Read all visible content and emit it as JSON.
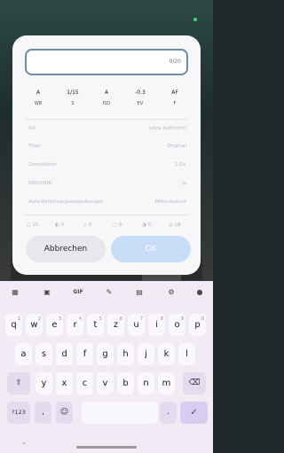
{
  "dialog": {
    "name_counter": "0/20",
    "params": [
      {
        "value": "A",
        "key": "WB"
      },
      {
        "value": "1/15",
        "key": "S"
      },
      {
        "value": "A",
        "key": "ISO"
      },
      {
        "value": "-0.3",
        "key": "EV"
      },
      {
        "value": "AF",
        "key": "F"
      }
    ],
    "rows": [
      {
        "label": "Stil",
        "value": "Leica Authentic"
      },
      {
        "label": "Filter",
        "value": "Original"
      },
      {
        "label": "Zoomfaktor",
        "value": "1.0×"
      },
      {
        "label": "DRO/HDR",
        "value": "Ja"
      },
      {
        "label": "Auto-Belichtungseinstellungen",
        "value": "Mittenbetont"
      }
    ],
    "counts": [
      "15",
      "0",
      "0",
      "0",
      "0",
      "18"
    ],
    "cancel_label": "Abbrechen",
    "ok_label": "OK"
  },
  "keyboard": {
    "toolbar": {
      "gif_label": "GIF"
    },
    "row1": [
      {
        "k": "q",
        "h": "1"
      },
      {
        "k": "w",
        "h": "2"
      },
      {
        "k": "e",
        "h": "3"
      },
      {
        "k": "r",
        "h": "4"
      },
      {
        "k": "t",
        "h": "5"
      },
      {
        "k": "z",
        "h": "6"
      },
      {
        "k": "u",
        "h": "7"
      },
      {
        "k": "i",
        "h": "8"
      },
      {
        "k": "o",
        "h": "9"
      },
      {
        "k": "p",
        "h": "0"
      }
    ],
    "row2": [
      "a",
      "s",
      "d",
      "f",
      "g",
      "h",
      "j",
      "k",
      "l"
    ],
    "row3": [
      "y",
      "x",
      "c",
      "v",
      "b",
      "n",
      "m"
    ],
    "symbols_label": "?123",
    "comma_label": ",",
    "period_label": "."
  }
}
